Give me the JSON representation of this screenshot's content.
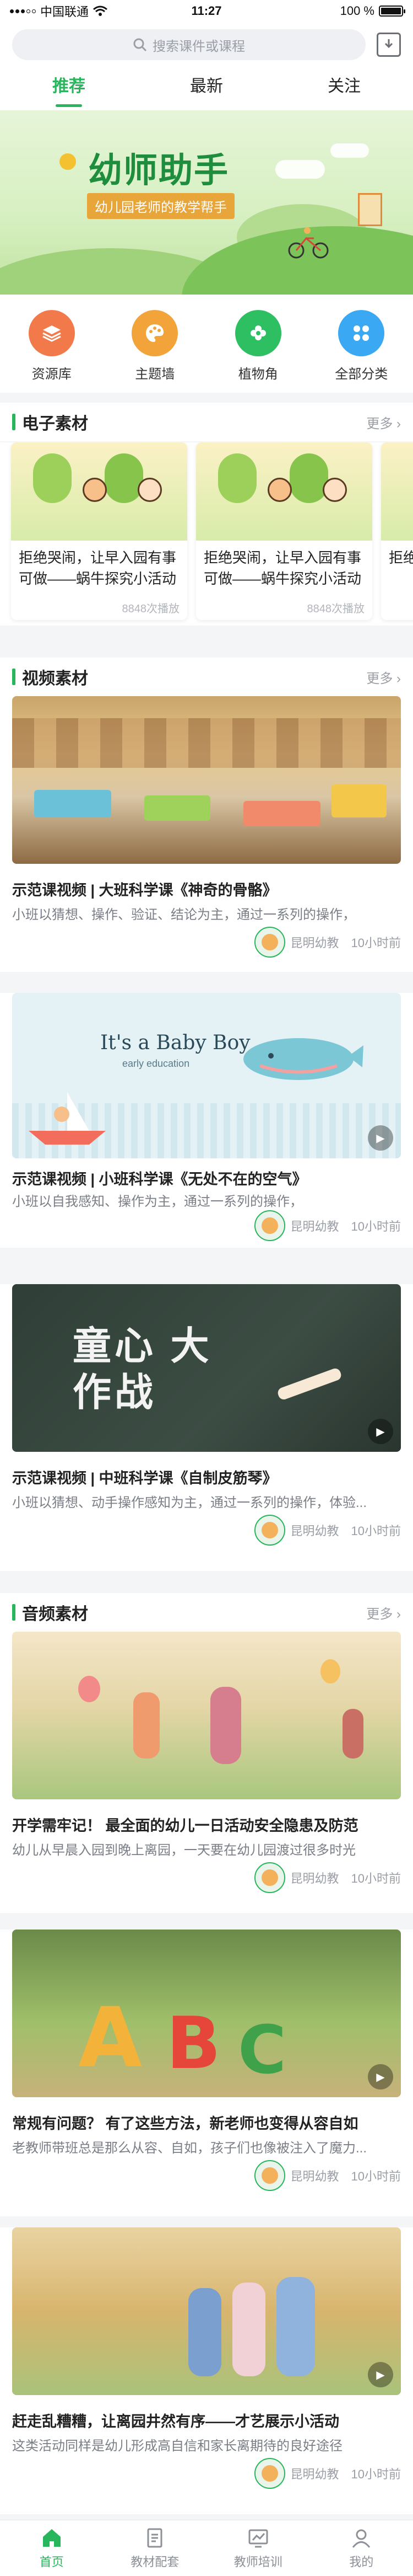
{
  "status_bar": {
    "carrier": "中国联通",
    "time": "11:27",
    "battery": "100 %"
  },
  "search": {
    "placeholder": "搜索课件或课程"
  },
  "tabs": [
    {
      "label": "推荐"
    },
    {
      "label": "最新"
    },
    {
      "label": "关注"
    }
  ],
  "banner": {
    "title": "幼师助手",
    "subtitle": "幼儿园老师的教学帮手"
  },
  "categories": [
    {
      "label": "资源库",
      "color": "#f27a4a"
    },
    {
      "label": "主题墙",
      "color": "#f2a33a"
    },
    {
      "label": "植物角",
      "color": "#2fbf63"
    },
    {
      "label": "全部分类",
      "color": "#3aa8f2"
    }
  ],
  "sections": {
    "electronic": {
      "title": "电子素材",
      "more": "更多"
    },
    "video": {
      "title": "视频素材",
      "more": "更多"
    },
    "audio": {
      "title": "音频素材",
      "more": "更多"
    }
  },
  "materials": [
    {
      "title": "拒绝哭闹，让早入园有事可做——蜗牛探究小活动",
      "plays": "8848次播放"
    },
    {
      "title": "拒绝哭闹，让早入园有事可做——蜗牛探究小活动",
      "plays": "8848次播放"
    },
    {
      "title": "拒绝"
    }
  ],
  "videos": [
    {
      "title": "示范课视频 | 大班科学课《神奇的骨骼》",
      "desc": "小班以猜想、操作、验证、结论为主，通过一系列的操作，",
      "author": "昆明幼教",
      "time": "10小时前",
      "caption": ""
    },
    {
      "title": "示范课视频 | 小班科学课《无处不在的空气》",
      "desc": "小班以自我感知、操作为主，通过一系列的操作，",
      "author": "昆明幼教",
      "time": "10小时前",
      "caption": "It's a Baby Boy",
      "caption2": "early education"
    },
    {
      "title": "示范课视频 | 中班科学课《自制皮筋琴》",
      "desc": "小班以猜想、动手操作感知为主，通过一系列的操作，体验...",
      "author": "昆明幼教",
      "time": "10小时前",
      "caption": "童心 大作战"
    }
  ],
  "audios": [
    {
      "title": "开学需牢记！ 最全面的幼儿一日活动安全隐患及防范",
      "desc": "幼儿从早晨入园到晚上离园，一天要在幼儿园渡过很多时光",
      "author": "昆明幼教",
      "time": "10小时前"
    },
    {
      "title": "常规有问题？ 有了这些方法，新老师也变得从容自如",
      "desc": "老教师带班总是那么从容、自如，孩子们也像被注入了魔力...",
      "author": "昆明幼教",
      "time": "10小时前"
    },
    {
      "title": "赶走乱糟糟，让离园井然有序——才艺展示小活动",
      "desc": "这类活动同样是幼儿形成高自信和家长离期待的良好途径",
      "author": "昆明幼教",
      "time": "10小时前"
    }
  ],
  "bottom_nav": [
    {
      "label": "首页",
      "active": true
    },
    {
      "label": "教材配套"
    },
    {
      "label": "教师培训"
    },
    {
      "label": "我的"
    }
  ],
  "colors": {
    "accent": "#27b65b",
    "background": "#f4f5f7"
  }
}
